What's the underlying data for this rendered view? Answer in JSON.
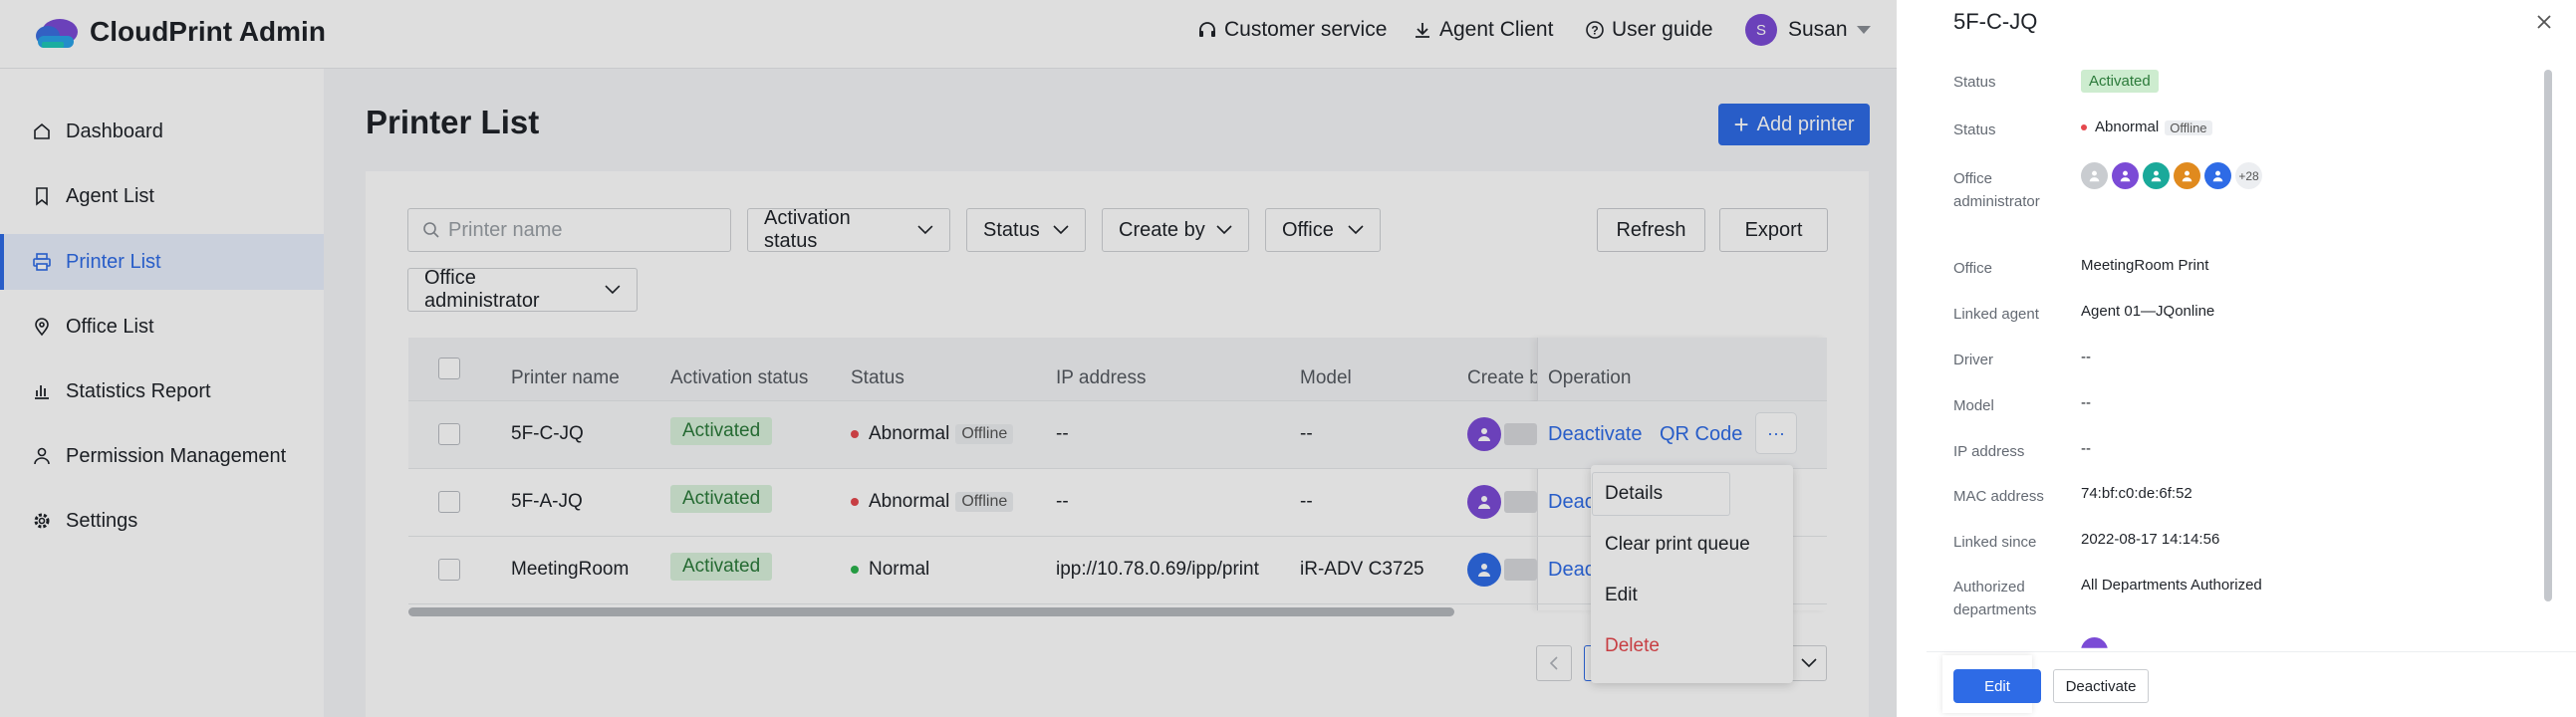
{
  "header": {
    "app_title": "CloudPrint Admin",
    "customer_service": "Customer service",
    "agent_client": "Agent Client",
    "user_guide": "User guide",
    "user_name": "Susan",
    "user_initial": "S"
  },
  "sidebar": {
    "items": [
      {
        "label": "Dashboard",
        "icon": "home-icon"
      },
      {
        "label": "Agent List",
        "icon": "bookmark-icon"
      },
      {
        "label": "Printer List",
        "icon": "printer-icon",
        "active": true
      },
      {
        "label": "Office List",
        "icon": "location-pin-icon"
      },
      {
        "label": "Statistics Report",
        "icon": "bar-chart-icon"
      },
      {
        "label": "Permission Management",
        "icon": "user-icon"
      },
      {
        "label": "Settings",
        "icon": "gear-icon"
      }
    ]
  },
  "page": {
    "title": "Printer List",
    "add_printer": "Add printer"
  },
  "filters": {
    "search_placeholder": "Printer name",
    "activation_status": "Activation status",
    "status": "Status",
    "create_by": "Create by",
    "office": "Office",
    "office_admin": "Office administrator",
    "refresh": "Refresh",
    "export": "Export"
  },
  "table": {
    "headers": [
      "Printer name",
      "Activation status",
      "Status",
      "IP address",
      "Model",
      "Create b",
      "Operation"
    ],
    "rows": [
      {
        "name": "5F-C-JQ",
        "activation": "Activated",
        "status": "Abnormal",
        "tag": "Offline",
        "ip": "--",
        "model": "--",
        "op1": "Deactivate",
        "op2": "QR Code"
      },
      {
        "name": "5F-A-JQ",
        "activation": "Activated",
        "status": "Abnormal",
        "tag": "Offline",
        "ip": "--",
        "model": "--",
        "op1": "Deac"
      },
      {
        "name": "MeetingRoom",
        "activation": "Activated",
        "status": "Normal",
        "ip": "ipp://10.78.0.69/ipp/print",
        "model": "iR-ADV C3725",
        "op1": "Deac"
      }
    ],
    "more": "···"
  },
  "menu": {
    "items": [
      "Details",
      "Clear print queue",
      "Edit",
      "Delete"
    ]
  },
  "panel": {
    "title": "5F-C-JQ",
    "fields": {
      "status1_label": "Status",
      "status1_value": "Activated",
      "status2_label": "Status",
      "status2_value": "Abnormal",
      "status2_tag": "Offline",
      "office_admin_label": "Office administrator",
      "admin_extra": "+28",
      "office_label": "Office",
      "office_value": "MeetingRoom Print",
      "agent_label": "Linked agent",
      "agent_value": "Agent 01—JQonline",
      "driver_label": "Driver",
      "driver_value": "--",
      "model_label": "Model",
      "model_value": "--",
      "ip_label": "IP address",
      "ip_value": "--",
      "mac_label": "MAC address",
      "mac_value": "74:bf:c0:de:6f:52",
      "since_label": "Linked since",
      "since_value": "2022-08-17 14:14:56",
      "dept_label": "Authorized departments",
      "dept_value": "All Departments Authorized"
    },
    "edit": "Edit",
    "deactivate": "Deactivate"
  },
  "colors": {
    "primary": "#2e6be6",
    "danger": "#e5484d",
    "success": "#2bb24c"
  }
}
